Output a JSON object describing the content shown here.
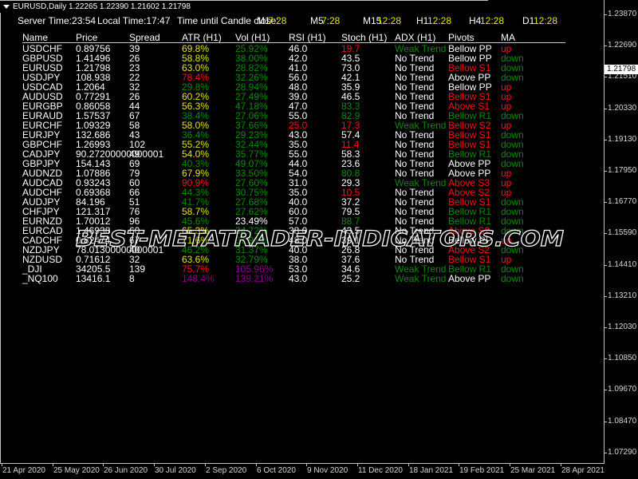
{
  "window": {
    "symbol_line": "EURUSD,Daily  1.22265 1.22390 1.21602 1.21798"
  },
  "times": {
    "server": "Server Time:23:54",
    "local": "Local Time:17:47",
    "until_close": "Time until Candle close:",
    "timeframes": [
      {
        "label": "M1",
        "value": "7:28"
      },
      {
        "label": "M5",
        "value": "7:28"
      },
      {
        "label": "M15",
        "value": "12:28"
      },
      {
        "label": "H1",
        "value": "12:28"
      },
      {
        "label": "H4",
        "value": "12:28"
      },
      {
        "label": "D1",
        "value": "12:28"
      }
    ]
  },
  "headers": [
    "Name",
    "Price",
    "Spread",
    "ATR (H1)",
    "Vol (H1)",
    "RSI (H1)",
    "Stoch (H1)",
    "ADX (H1)",
    "Pivots",
    "MA"
  ],
  "colors": {
    "white": "#ffffff",
    "yellow": "#e6e600",
    "green": "#0a8a00",
    "red": "#ff1010",
    "purple": "#8a008a"
  },
  "rows": [
    {
      "cells": [
        "USDCHF",
        "0.89756",
        "39",
        "69.8%",
        "25.92%",
        "46.0",
        "19.7",
        "Weak Trend",
        "Bellow PP",
        "up"
      ],
      "colors": "wwwygwrgwr"
    },
    {
      "cells": [
        "GBPUSD",
        "1.41496",
        "26",
        "58.8%",
        "38.00%",
        "42.0",
        "43.5",
        "No Trend",
        "Bellow PP",
        "down"
      ],
      "colors": "wwwygwwwwg"
    },
    {
      "cells": [
        "EURUSD",
        "1.21798",
        "23",
        "63.0%",
        "28.82%",
        "41.0",
        "73.0",
        "No Trend",
        "Bellow S1",
        "down"
      ],
      "colors": "wwwygwwwrg"
    },
    {
      "cells": [
        "USDJPY",
        "108.938",
        "22",
        "78.4%",
        "32.26%",
        "56.0",
        "42.1",
        "No Trend",
        "Above PP",
        "down"
      ],
      "colors": "wwwrgwwwwg"
    },
    {
      "cells": [
        "USDCAD",
        "1.2064",
        "32",
        "29.8%",
        "28.94%",
        "48.0",
        "35.9",
        "No Trend",
        "Bellow PP",
        "up"
      ],
      "colors": "wwwggwwwwr"
    },
    {
      "cells": [
        "AUDUSD",
        "0.77291",
        "26",
        "60.2%",
        "27.49%",
        "39.0",
        "46.5",
        "No Trend",
        "Bellow S1",
        "up"
      ],
      "colors": "wwwygwwwrr"
    },
    {
      "cells": [
        "EURGBP",
        "0.86058",
        "44",
        "56.3%",
        "47.18%",
        "47.0",
        "83.3",
        "No Trend",
        "Above S1",
        "up"
      ],
      "colors": "wwwygwgwrr"
    },
    {
      "cells": [
        "EURAUD",
        "1.57537",
        "67",
        "38.4%",
        "27.06%",
        "55.0",
        "82.9",
        "No Trend",
        "Bellow R1",
        "down"
      ],
      "colors": "wwwggwgwgg"
    },
    {
      "cells": [
        "EURCHF",
        "1.09329",
        "58",
        "58.0%",
        "37.66%",
        "25.0",
        "17.3",
        "Weak Trend",
        "Bellow S2",
        "up"
      ],
      "colors": "wwwygrrgrr"
    },
    {
      "cells": [
        "EURJPY",
        "132.686",
        "43",
        "36.4%",
        "29.23%",
        "43.0",
        "57.4",
        "No Trend",
        "Bellow S1",
        "down"
      ],
      "colors": "wwwggwwwrg"
    },
    {
      "cells": [
        "GBPCHF",
        "1.26993",
        "102",
        "55.2%",
        "32.44%",
        "35.0",
        "11.4",
        "No Trend",
        "Bellow S1",
        "down"
      ],
      "colors": "wwwygwrwrg"
    },
    {
      "cells": [
        "CADJPY",
        "90.27200000000001",
        "49",
        "54.0%",
        "35.77%",
        "55.0",
        "58.3",
        "No Trend",
        "Bellow R1",
        "down"
      ],
      "colors": "wwwygwwwgg"
    },
    {
      "cells": [
        "GBPJPY",
        "154.143",
        "69",
        "40.3%",
        "49.07%",
        "44.0",
        "23.6",
        "No Trend",
        "Above PP",
        "down"
      ],
      "colors": "wwwggwwwwg"
    },
    {
      "cells": [
        "AUDNZD",
        "1.07886",
        "79",
        "67.9%",
        "33.50%",
        "54.0",
        "80.8",
        "No Trend",
        "Above PP",
        "up"
      ],
      "colors": "wwwygwgwwr"
    },
    {
      "cells": [
        "AUDCAD",
        "0.93243",
        "60",
        "90.9%",
        "27.60%",
        "31.0",
        "29.3",
        "Weak Trend",
        "Above S3",
        "up"
      ],
      "colors": "wwwrgwwgrr"
    },
    {
      "cells": [
        "AUDCHF",
        "0.69368",
        "66",
        "44.3%",
        "30.75%",
        "35.0",
        "10.5",
        "No Trend",
        "Above S2",
        "up"
      ],
      "colors": "wwwggwrwrr"
    },
    {
      "cells": [
        "AUDJPY",
        "84.196",
        "51",
        "41.7%",
        "27.68%",
        "40.0",
        "37.2",
        "No Trend",
        "Bellow S1",
        "down"
      ],
      "colors": "wwwggwwwrg"
    },
    {
      "cells": [
        "CHFJPY",
        "121.317",
        "76",
        "58.7%",
        "27.62%",
        "60.0",
        "79.5",
        "No Trend",
        "Bellow R1",
        "down"
      ],
      "colors": "wwwygwwwgg"
    },
    {
      "cells": [
        "EURNZD",
        "1.70012",
        "96",
        "45.6%",
        "23.49%",
        "57.0",
        "88.7",
        "No Trend",
        "Bellow R1",
        "down"
      ],
      "colors": "wwwgwwgwgg"
    },
    {
      "cells": [
        "EURCAD",
        "1.46938",
        "60",
        "65.3%",
        "34.72%",
        "38.0",
        "43.5",
        "No Trend",
        "Above S2",
        "down"
      ],
      "colors": "wwwygwwwrg"
    },
    {
      "cells": [
        "CADCHF",
        "0.82474",
        "67",
        "71.6%",
        "37.91%",
        "48.0",
        "39.1",
        "No Trend",
        "Bellow PP",
        "up"
      ],
      "colors": "wwwygwwwwr"
    },
    {
      "cells": [
        "NZDJPY",
        "78.01300000000001",
        "40",
        "46.2%",
        "31.37%",
        "40.0",
        "26.8",
        "No Trend",
        "Above S2",
        "down"
      ],
      "colors": "wwwggwwwrg"
    },
    {
      "cells": [
        "NZDUSD",
        "0.71612",
        "32",
        "63.6%",
        "32.79%",
        "38.0",
        "37.6",
        "No Trend",
        "Bellow S1",
        "up"
      ],
      "colors": "wwwygwwwrr"
    },
    {
      "cells": [
        "_DJI",
        "34205.5",
        "139",
        "75.7%",
        "105.96%",
        "53.0",
        "34.6",
        "Weak Trend",
        "Bellow R1",
        "down"
      ],
      "colors": "wwwrpwwggg"
    },
    {
      "cells": [
        "_NQ100",
        "13416.1",
        "8",
        "148.4%",
        "139.21%",
        "43.0",
        "25.2",
        "Weak Trend",
        "Above PP",
        "down"
      ],
      "colors": "wwwppwwgwg"
    }
  ],
  "price_axis": [
    "1.23870",
    "1.22690",
    "1.21510",
    "1.20330",
    "1.19130",
    "1.17950",
    "1.16770",
    "1.15590",
    "1.14410",
    "1.13210",
    "1.12030",
    "1.10850",
    "1.09670",
    "1.08470",
    "1.07290"
  ],
  "current_price": "1.21798",
  "date_axis": [
    "21 Apr 2020",
    "25 May 2020",
    "26 Jun 2020",
    "30 Jul 2020",
    "2 Sep 2020",
    "6 Oct 2020",
    "9 Nov 2020",
    "11 Dec 2020",
    "18 Jan 2021",
    "19 Feb 2021",
    "25 Mar 2021",
    "28 Apr 2021"
  ],
  "watermark": "BEST-METATRADER-INDICATORS.COM"
}
